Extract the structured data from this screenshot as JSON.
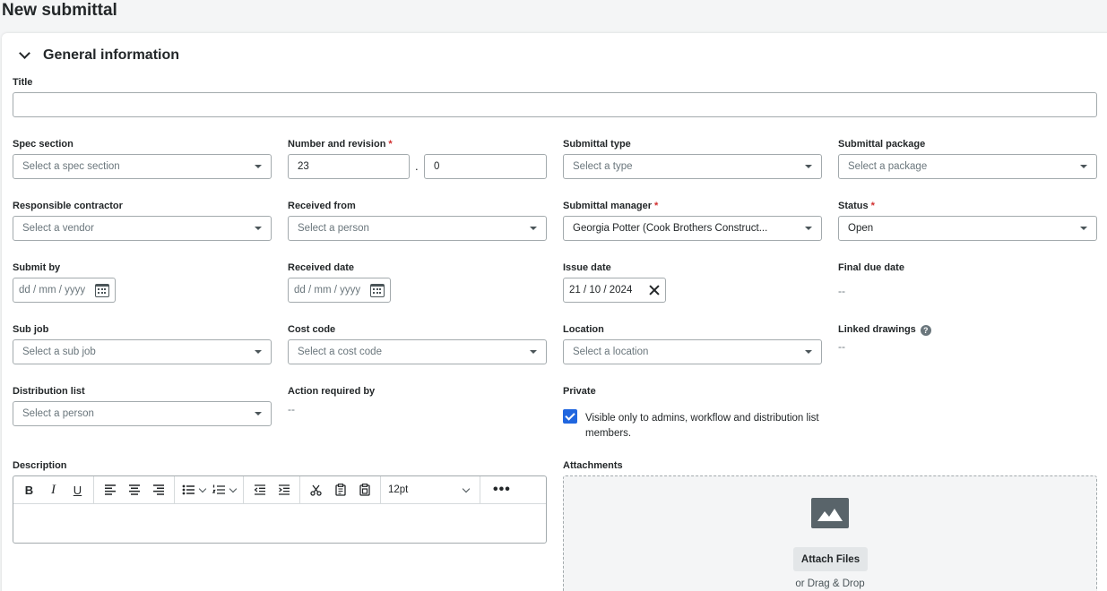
{
  "page": {
    "title": "New submittal"
  },
  "section": {
    "title": "General information"
  },
  "fields": {
    "title": {
      "label": "Title",
      "value": ""
    },
    "spec_section": {
      "label": "Spec section",
      "placeholder": "Select a spec section"
    },
    "number_revision": {
      "label": "Number and revision",
      "required": "*",
      "number": "23",
      "separator": ".",
      "revision": "0"
    },
    "submittal_type": {
      "label": "Submittal type",
      "placeholder": "Select a type"
    },
    "submittal_package": {
      "label": "Submittal package",
      "placeholder": "Select a package"
    },
    "responsible_contractor": {
      "label": "Responsible contractor",
      "placeholder": "Select a vendor"
    },
    "received_from": {
      "label": "Received from",
      "placeholder": "Select a person"
    },
    "submittal_manager": {
      "label": "Submittal manager",
      "required": "*",
      "value": "Georgia Potter (Cook Brothers Construct..."
    },
    "status": {
      "label": "Status",
      "required": "*",
      "value": "Open"
    },
    "submit_by": {
      "label": "Submit by",
      "placeholder": "dd / mm / yyyy"
    },
    "received_date": {
      "label": "Received date",
      "placeholder": "dd / mm / yyyy"
    },
    "issue_date": {
      "label": "Issue date",
      "value": "21 / 10 / 2024"
    },
    "final_due_date": {
      "label": "Final due date",
      "value": "--"
    },
    "sub_job": {
      "label": "Sub job",
      "placeholder": "Select a sub job"
    },
    "cost_code": {
      "label": "Cost code",
      "placeholder": "Select a cost code"
    },
    "location": {
      "label": "Location",
      "placeholder": "Select a location"
    },
    "linked_drawings": {
      "label": "Linked drawings",
      "help": "?",
      "value": "--"
    },
    "distribution_list": {
      "label": "Distribution list",
      "placeholder": "Select a person"
    },
    "action_required_by": {
      "label": "Action required by",
      "value": "--"
    },
    "private": {
      "label": "Private",
      "checked": true,
      "text": "Visible only to admins, workflow and distribution list members."
    },
    "description": {
      "label": "Description",
      "font_size": "12pt",
      "more": "•••"
    },
    "attachments": {
      "label": "Attachments",
      "button": "Attach Files",
      "hint": "or Drag & Drop"
    }
  },
  "colors": {
    "accent": "#2066df",
    "required": "#d12f2f",
    "border": "#a3aaad"
  }
}
